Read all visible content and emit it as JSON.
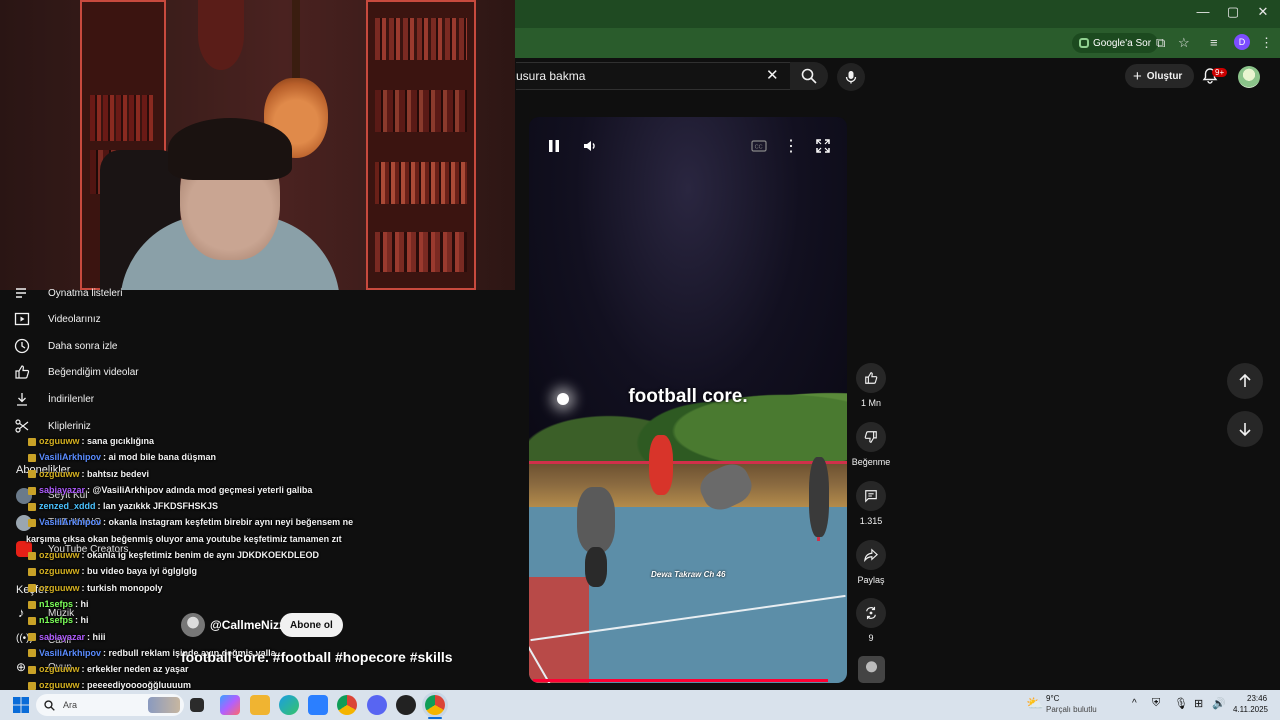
{
  "browser": {
    "google_sor_label": "Google'a Sor",
    "profile_initial": "D",
    "window_controls": [
      "—",
      "▢",
      "✕"
    ]
  },
  "youtube_header": {
    "search_value": "usura bakma",
    "create_label": "Oluştur",
    "notification_count": "9+"
  },
  "sidebar": {
    "items": [
      {
        "icon": "playlist-icon",
        "label": "Oynatma listeleri"
      },
      {
        "icon": "your-videos-icon",
        "label": "Videolarınız"
      },
      {
        "icon": "watch-later-icon",
        "label": "Daha sonra izle"
      },
      {
        "icon": "liked-videos-icon",
        "label": "Beğendiğim videolar"
      },
      {
        "icon": "download-icon",
        "label": "İndirilenler"
      },
      {
        "icon": "scissors-icon",
        "label": "Klipleriniz"
      }
    ],
    "subscriptions_heading": "Abonelikler",
    "subscriptions": [
      "Seyit Kul",
      "THE WANG",
      "YouTube Creators"
    ],
    "explore_heading": "Keşfet",
    "explore": [
      "Müzik",
      "Canlı",
      "Oyun"
    ]
  },
  "chat": [
    {
      "user": "ozguuww",
      "color": "#d4b021",
      "text": ": sana gıcıklığına"
    },
    {
      "user": "VasiliArkhipov",
      "color": "#5a8cff",
      "text": ": ai mod bile bana düşman"
    },
    {
      "user": "ozguuww",
      "color": "#d4b021",
      "text": ": bahtsız bedevi"
    },
    {
      "user": "sabiayazar",
      "color": "#b05cff",
      "text": ": @VasiliArkhipov adında mod geçmesi yeterli galiba"
    },
    {
      "user": "zenzed_xddd",
      "color": "#4bc3ff",
      "text": ": lan yazıkkk JFKDSFHSKJS"
    },
    {
      "user": "VasiliArkhipov",
      "color": "#5a8cff",
      "text": ": okanla instagram keşfetim birebir aynı neyi beğensem ne"
    },
    {
      "user": "",
      "color": "#f1f1f1",
      "text": "karşıma çıksa okan beğenmiş oluyor ama youtube keşfetimiz tamamen zıt"
    },
    {
      "user": "ozguuww",
      "color": "#d4b021",
      "text": ": okanla ig keşfetimiz benim de aynı JDKDKOEKDLEOD"
    },
    {
      "user": "ozguuww",
      "color": "#d4b021",
      "text": ": bu video baya iyi öglglglg"
    },
    {
      "user": "ozguuww",
      "color": "#d4b021",
      "text": ": turkish monopoly"
    },
    {
      "user": "n1sefps",
      "color": "#7cff5a",
      "text": ": hi"
    },
    {
      "user": "n1sefps",
      "color": "#7cff5a",
      "text": ": hi"
    },
    {
      "user": "sabiayazar",
      "color": "#b05cff",
      "text": ": hiii"
    },
    {
      "user": "VasiliArkhipov",
      "color": "#5a8cff",
      "text": ": redbull reklam işinde ayıp değmiş valla"
    },
    {
      "user": "ozguuww",
      "color": "#d4b021",
      "text": ": erkekler neden az yaşar"
    },
    {
      "user": "ozguuww",
      "color": "#d4b021",
      "text": ": peeeediyooooğğluuuum"
    }
  ],
  "short": {
    "channel": "@CallmeNizz",
    "subscribe_label": "Abone ol",
    "title": "football core. #football #hopecore #skills",
    "caption": "football core.",
    "watermark": "Dewa Takraw Ch 46",
    "progress_fraction": 0.95
  },
  "actions": {
    "like_count": "1 Mn",
    "dislike_label": "Beğenme",
    "comment_count": "1.315",
    "share_label": "Paylaş",
    "remix_count": "9"
  },
  "taskbar": {
    "search_placeholder": "Ara",
    "weather_temp": "9°C",
    "weather_desc": "Parçalı bulutlu",
    "time": "23:46",
    "date": "4.11.2025"
  }
}
